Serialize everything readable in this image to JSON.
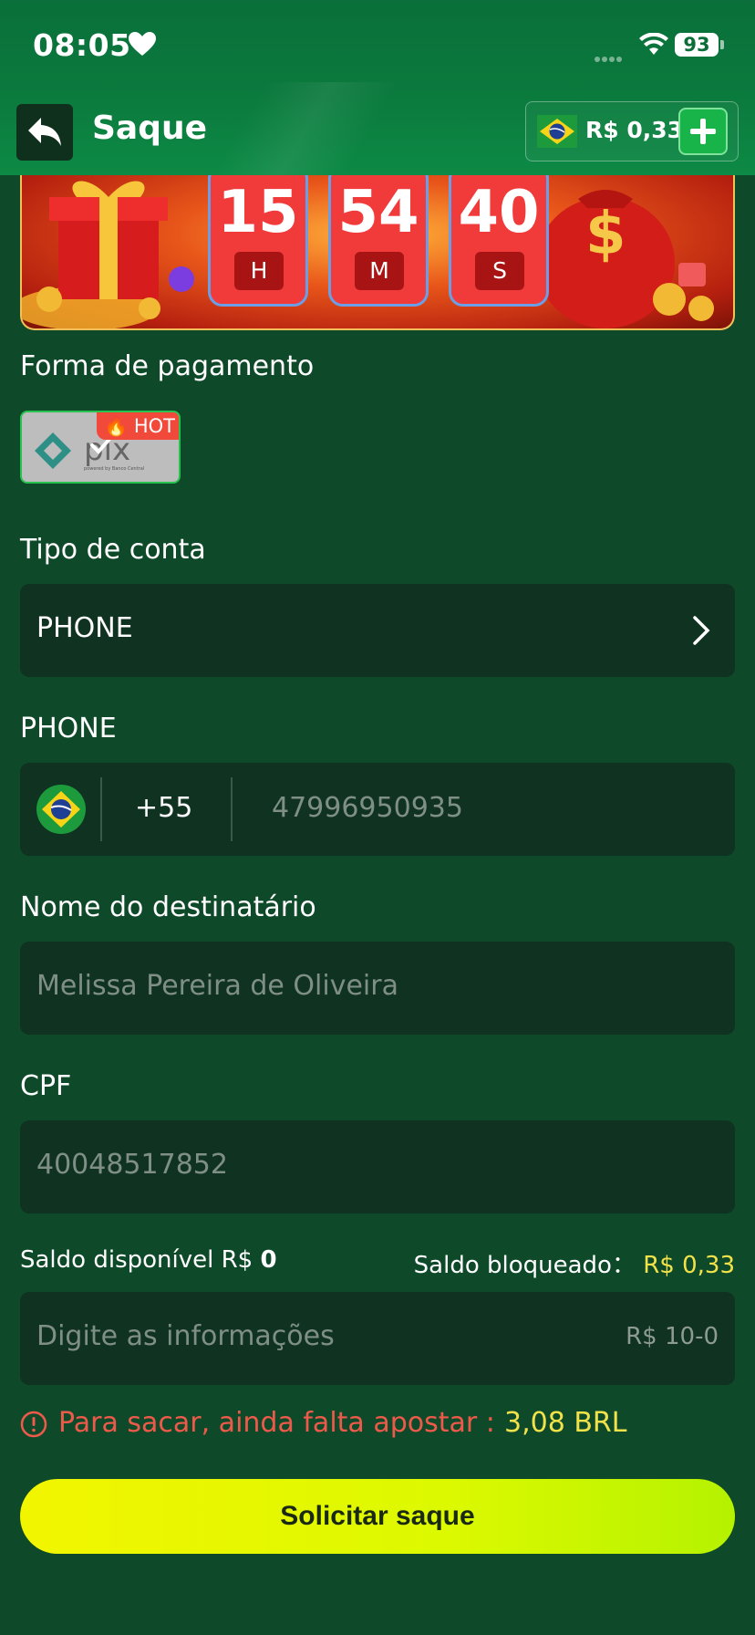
{
  "status_bar": {
    "time": "08:05",
    "battery": "93"
  },
  "header": {
    "title": "Saque",
    "balance": "R$ 0,33"
  },
  "timer": [
    {
      "value": "15",
      "unit": "H"
    },
    {
      "value": "54",
      "unit": "M"
    },
    {
      "value": "40",
      "unit": "S"
    }
  ],
  "payment": {
    "label": "Forma de pagamento",
    "method": "pix",
    "method_subtitle": "powered by Banco Central",
    "badge": "HOT"
  },
  "account_type": {
    "label": "Tipo de conta",
    "value": "PHONE"
  },
  "phone": {
    "label": "PHONE",
    "country_code": "+55",
    "number": "47996950935"
  },
  "recipient": {
    "label": "Nome do destinatário",
    "value": "Melissa Pereira de Oliveira"
  },
  "cpf": {
    "label": "CPF",
    "value": "40048517852"
  },
  "balances": {
    "available_label": "Saldo disponível R$",
    "available_value": "0",
    "blocked_label": "Saldo bloqueado：",
    "blocked_value": "R$ 0,33"
  },
  "amount": {
    "placeholder": "Digite as informações",
    "range": "R$ 10-0"
  },
  "warning": {
    "text": "Para sacar, ainda falta apostar :",
    "value": "3,08 BRL"
  },
  "submit_label": "Solicitar saque",
  "colors": {
    "header": "#0b7a3d",
    "background": "#0e4a2a",
    "field": "#0f3221",
    "accent_yellow": "#f2e24a",
    "warning": "#ee5a4a",
    "submit": "#e8f800"
  }
}
